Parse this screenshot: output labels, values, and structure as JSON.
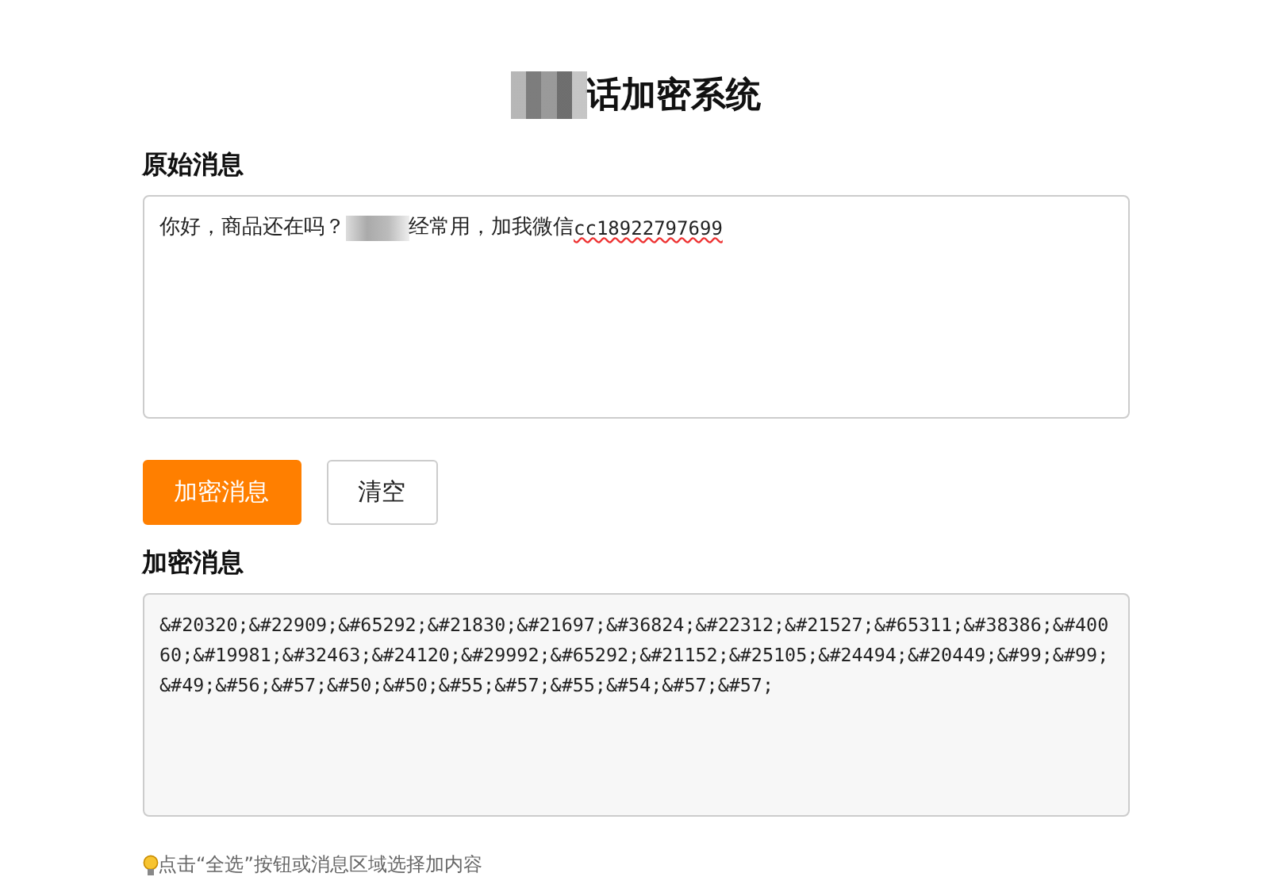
{
  "title": {
    "hidden_part": true,
    "text": "话加密系统"
  },
  "original": {
    "label": "原始消息",
    "value_before": "你好，商品还在吗？",
    "value_after": "经常用，加我微信",
    "value_flagged": "cc18922797699"
  },
  "buttons": [
    {
      "label": "加密消息",
      "kind": "primary"
    },
    {
      "label": "清空",
      "kind": "secondary"
    }
  ],
  "encrypted": {
    "label": "加密消息",
    "value": "&#20320;&#22909;&#65292;&#21830;&#21697;&#36824;&#22312;&#21527;&#65311;&#38386;&#40060;&#19981;&#32463;&#24120;&#29992;&#65292;&#21152;&#25105;&#24494;&#20449;&#99;&#99;&#49;&#56;&#57;&#50;&#50;&#55;&#57;&#55;&#54;&#57;&#57;"
  },
  "hint": "点击“全选”按钮或消息区域选择加内容"
}
